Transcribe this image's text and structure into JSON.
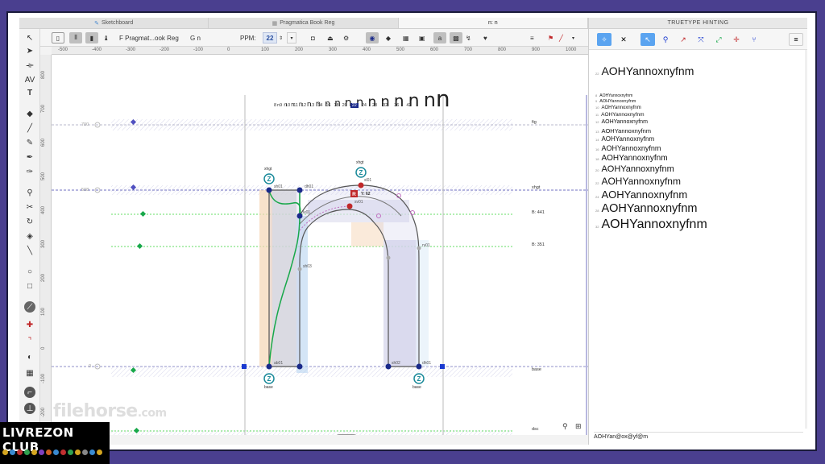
{
  "tabs": [
    {
      "label": "Sketchboard",
      "active": false
    },
    {
      "label": "Pragmatica Book Reg",
      "active": false
    },
    {
      "label": "n: n",
      "active": true
    }
  ],
  "toolbar": {
    "font_label": "F  Pragmat...ook Reg",
    "glyph_label": "G n",
    "ppm_label": "PPM:",
    "ppm_value": "22"
  },
  "ruler": {
    "h": [
      "-500",
      "-400",
      "-300",
      "-200",
      "-100",
      "0",
      "100",
      "200",
      "300",
      "400",
      "500",
      "600",
      "700",
      "800",
      "900",
      "1000"
    ],
    "v": [
      "800",
      "700",
      "600",
      "500",
      "400",
      "300",
      "200",
      "100",
      "0",
      "-100",
      "-200"
    ]
  },
  "canvas": {
    "waterfall_sizes": [
      "8",
      "9",
      "10",
      "11",
      "12",
      "13",
      "14",
      "16",
      "18",
      "20",
      "22",
      "24",
      "28",
      "32",
      "36",
      "42"
    ],
    "waterfall_selected": "22",
    "lines": {
      "fig": "fig",
      "xhgt": "xhgt",
      "b441": "B: 441",
      "b351": "B: 351",
      "base": "base",
      "dsc": "dsc"
    },
    "margin_marks": {
      "m700": "700",
      "m508": "508",
      "m0": "0"
    },
    "point_labels": {
      "xhgt_left": "xhgt",
      "xhgt_top": "xhgt",
      "base_left": "base",
      "base_right": "base",
      "sh01": "sh01",
      "dh01": "dh01",
      "sl01": "sl01",
      "lv01": "lv01",
      "sv01": "sv01",
      "rv01": "rv01",
      "sh03": "sh03",
      "ab01": "ab01",
      "sh02": "sh02",
      "dh01b": "dh01",
      "y62": "Y: 62"
    },
    "advance_width": "573"
  },
  "panel": {
    "title": "TRUETYPE HINTING",
    "big_sample": "AOHYannoxnyfnm",
    "waterfall": [
      {
        "size": "8",
        "text": "AOHYannoxnyfnm"
      },
      {
        "size": "9",
        "text": "AOHYannoxnyfnm"
      },
      {
        "size": "10",
        "text": "AOHYannoxnyfnm"
      },
      {
        "size": "11",
        "text": "AOHYannoxnyfnm"
      },
      {
        "size": "12",
        "text": "AOHYannoxnyfnm"
      },
      {
        "size": "13",
        "text": "AOHYannoxnyfnm"
      },
      {
        "size": "14",
        "text": "AOHYannoxnyfnm"
      },
      {
        "size": "16",
        "text": "AOHYannoxnyfnm"
      },
      {
        "size": "18",
        "text": "AOHYannoxnyfnm"
      },
      {
        "size": "20",
        "text": "AOHYannoxnyfnm"
      },
      {
        "size": "22",
        "text": "AOHYannoxnyfnm"
      },
      {
        "size": "24",
        "text": "AOHYannoxnyfnm"
      },
      {
        "size": "28",
        "text": "AOHYannoxnyfnm"
      },
      {
        "size": "32",
        "text": "AOHYannoxnyfnm"
      }
    ],
    "big_sample_size": "22",
    "input_text": "AOHYan@ox@yf@m"
  },
  "watermark": {
    "logo_text": "LIVREZON CLUB",
    "filehorse": "filehorse",
    "filehorse_tld": ".com"
  },
  "colors": {
    "accent": "#5ba4f0",
    "frame": "#4a3f8f",
    "hint_green": "#18a84a",
    "hint_teal": "#1a8a9a",
    "node_blue": "#1a2a8a",
    "hint_red": "#c0282a"
  }
}
